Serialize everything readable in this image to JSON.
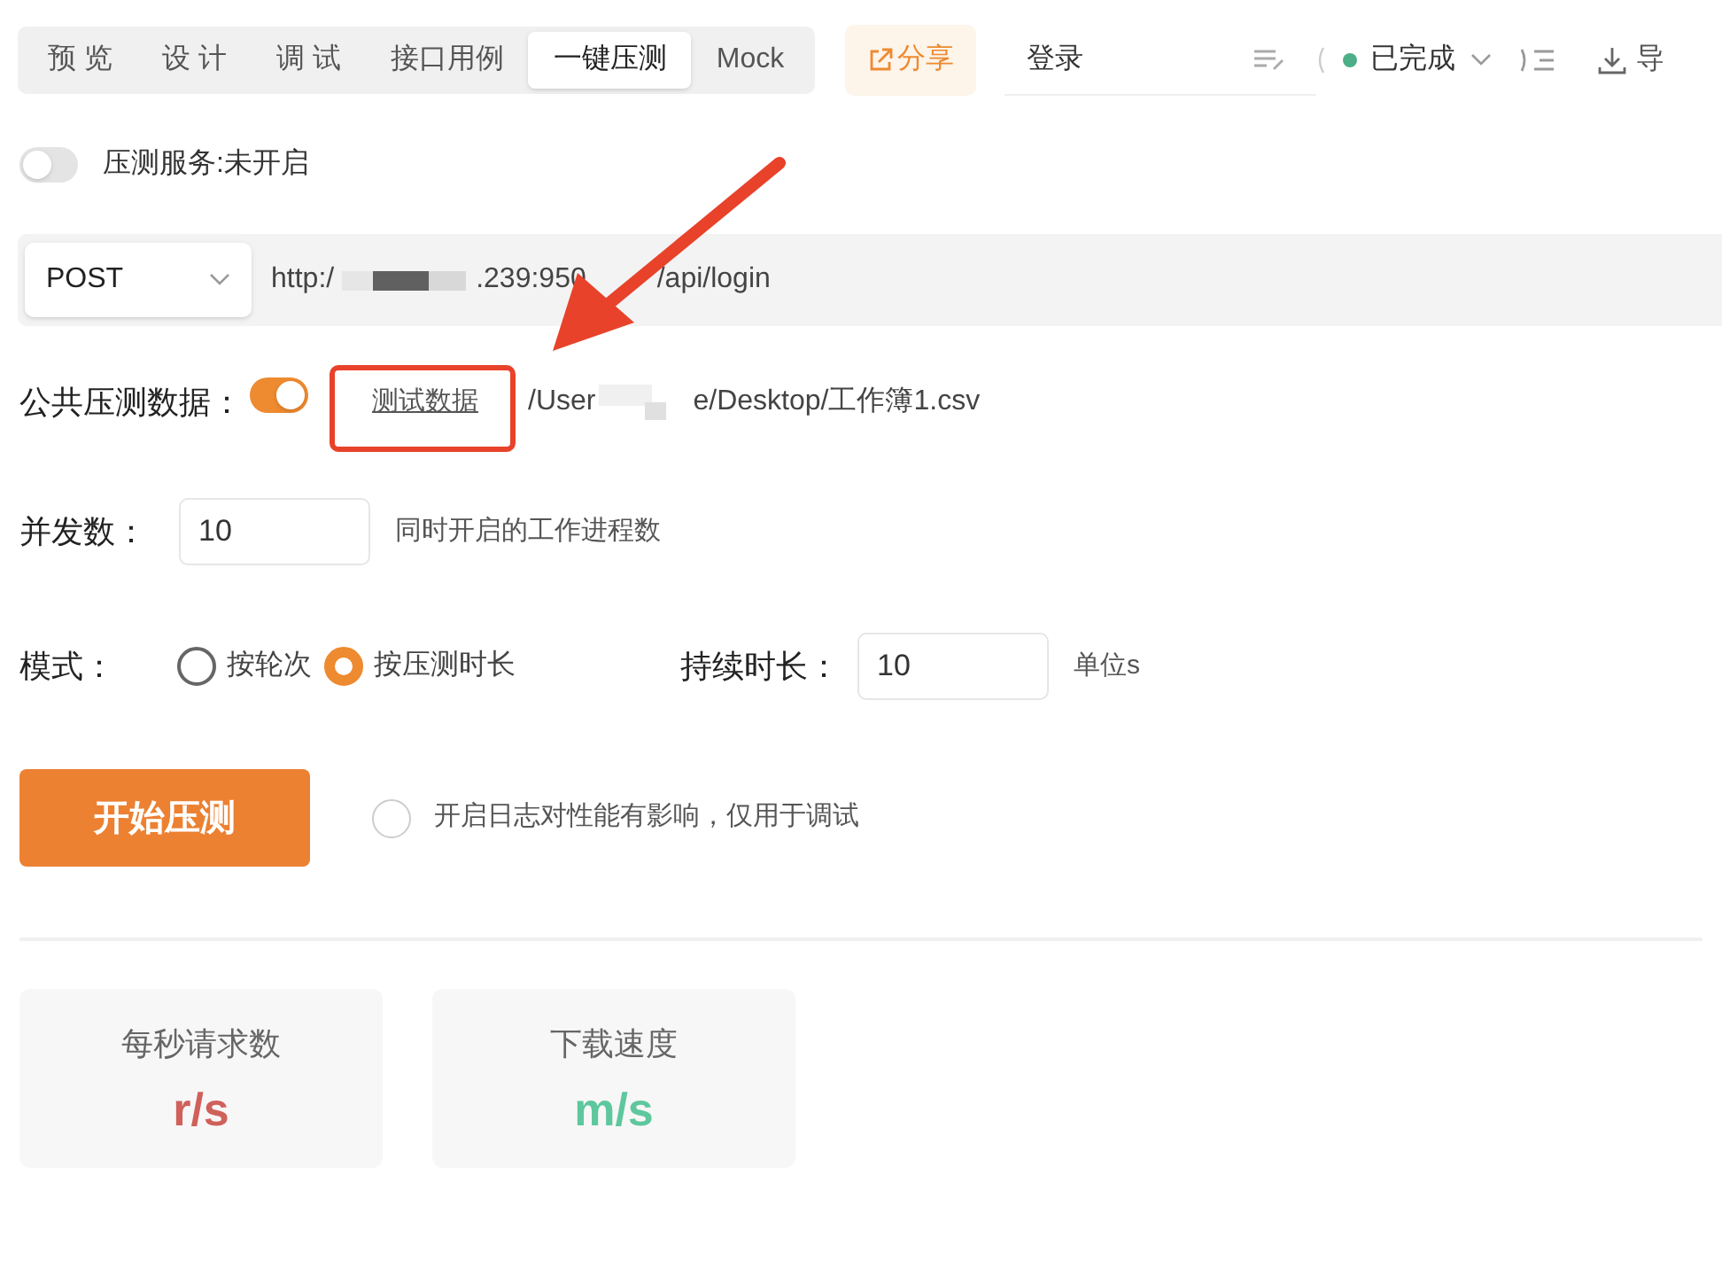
{
  "tabs": [
    {
      "label": "预 览",
      "selected": false
    },
    {
      "label": "设 计",
      "selected": false
    },
    {
      "label": "调 试",
      "selected": false
    },
    {
      "label": "接口用例",
      "selected": false
    },
    {
      "label": "一键压测",
      "selected": true
    },
    {
      "label": "Mock",
      "selected": false
    }
  ],
  "share_button": "分享",
  "title_field": {
    "value": "登录"
  },
  "status": {
    "label": "已完成",
    "color": "#4caf88"
  },
  "import_button": "导",
  "service_switch": {
    "label": "压测服务:未开启",
    "on": false
  },
  "request": {
    "method": "POST",
    "url_parts": [
      "http:/",
      ".239:950",
      "/api/login"
    ]
  },
  "public_data": {
    "label": "公共压测数据：",
    "on": true,
    "link": "测试数据",
    "path_parts": [
      "/User",
      "e/Desktop/工作簿1.csv"
    ]
  },
  "concurrency": {
    "label": "并发数：",
    "value": "10",
    "hint": "同时开启的工作进程数"
  },
  "mode": {
    "label": "模式：",
    "options": [
      {
        "label": "按轮次",
        "selected": false
      },
      {
        "label": "按压测时长",
        "selected": true
      }
    ]
  },
  "duration": {
    "label": "持续时长：",
    "value": "10",
    "unit": "单位s"
  },
  "start_button": "开始压测",
  "log_option": {
    "label": "开启日志对性能有影响，仅用于调试",
    "checked": false
  },
  "stats": [
    {
      "title": "每秒请求数",
      "value": "r/s",
      "color": "#d0605a"
    },
    {
      "title": "下载速度",
      "value": "m/s",
      "color": "#5ec79e"
    }
  ]
}
